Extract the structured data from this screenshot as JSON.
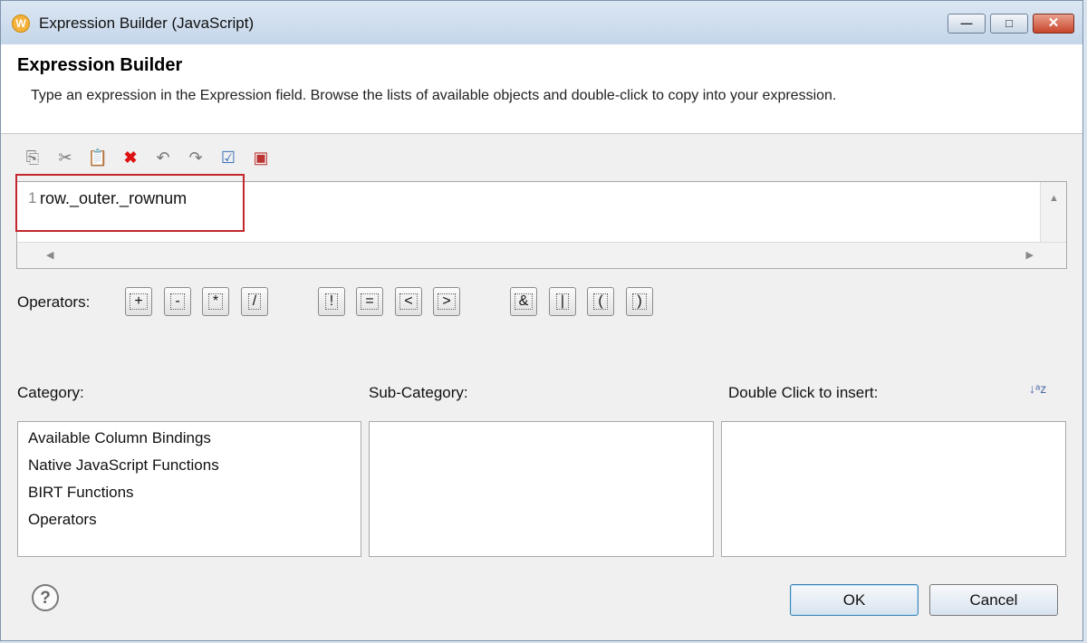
{
  "window": {
    "title": "Expression Builder (JavaScript)",
    "icon": "W",
    "min_label": "—",
    "max_label": "□",
    "close_label": "✕"
  },
  "header": {
    "title": "Expression Builder",
    "description": "Type an expression in the Expression field. Browse the lists of available objects and double-click to copy into your expression."
  },
  "toolbar": [
    "copy-icon",
    "cut-icon",
    "paste-icon",
    "delete-icon",
    "undo-icon",
    "redo-icon",
    "validate-icon",
    "calculate-icon"
  ],
  "editor": {
    "line_number": "1",
    "code": "row._outer._rownum",
    "up": "▲",
    "left": "◀",
    "right": "▶"
  },
  "operators": {
    "label": "Operators:",
    "items": [
      "+",
      "-",
      "*",
      "/",
      "!",
      "=",
      "<",
      ">",
      "&",
      "|",
      "(",
      ")"
    ]
  },
  "category": {
    "label": "Category:",
    "items": [
      "Available Column Bindings",
      "Native JavaScript Functions",
      "BIRT Functions",
      "Operators"
    ]
  },
  "sub_category": {
    "label": "Sub-Category:"
  },
  "insert": {
    "label": "Double Click to insert:",
    "sort_glyph": "↓ᵃz"
  },
  "footer": {
    "help": "?",
    "ok": "OK",
    "cancel": "Cancel"
  }
}
